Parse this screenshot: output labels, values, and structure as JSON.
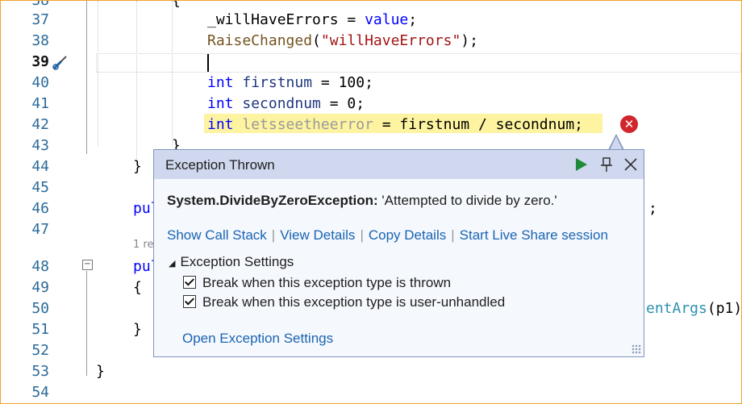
{
  "editor": {
    "line_numbers": [
      "38",
      "37",
      "38",
      "39",
      "40",
      "41",
      "42",
      "43",
      "44",
      "45",
      "46",
      "47",
      "48",
      "49",
      "50",
      "51",
      "52",
      "53",
      "54"
    ],
    "current_line": "39",
    "lines": {
      "l37_var": "_willHaveErrors",
      "l37_op": " = ",
      "l37_kw": "value",
      "l37_end": ";",
      "l38_method": "RaiseChanged",
      "l38_open": "(",
      "l38_str": "\"willHaveErrors\"",
      "l38_close": ");",
      "l40_kw": "int",
      "l40_var": " firstnum",
      "l40_rest": " = 100;",
      "l41_kw": "int",
      "l41_var": " secondnum",
      "l41_rest": " = 0;",
      "l42_kw": "int",
      "l42_var": " letsseetheerror",
      "l42_rest": " = firstnum / secondnum;",
      "l43": "}",
      "l44": "}",
      "l46_pub": "pul",
      "l46_tail": ";",
      "codelens": "1 re",
      "l48_pub": "pul",
      "l49": "{",
      "l50_method": "entArgs",
      "l50_tail": "(p1)",
      "l51": "}",
      "l53": "}",
      "top_brace": "{"
    }
  },
  "popup": {
    "title": "Exception Thrown",
    "exception_type": "System.DivideByZeroException:",
    "exception_message": " 'Attempted to divide by zero.'",
    "links": [
      "Show Call Stack",
      "View Details",
      "Copy Details",
      "Start Live Share session"
    ],
    "settings_header": "Exception Settings",
    "checkbox_thrown": "Break when this exception type is thrown",
    "checkbox_unhandled": "Break when this exception type is user-unhandled",
    "open_settings": "Open Exception Settings",
    "continue_icon": "play-icon",
    "pin_icon": "pin-icon",
    "close_icon": "close-icon",
    "error_icon": "error-x-icon"
  },
  "colors": {
    "keyword": "#0000ff",
    "string": "#a31515",
    "method": "#74531f",
    "highlight": "#fdf3a0",
    "error_badge": "#d1262b",
    "link": "#1a64b4",
    "title_bar": "#cfd8ee"
  }
}
